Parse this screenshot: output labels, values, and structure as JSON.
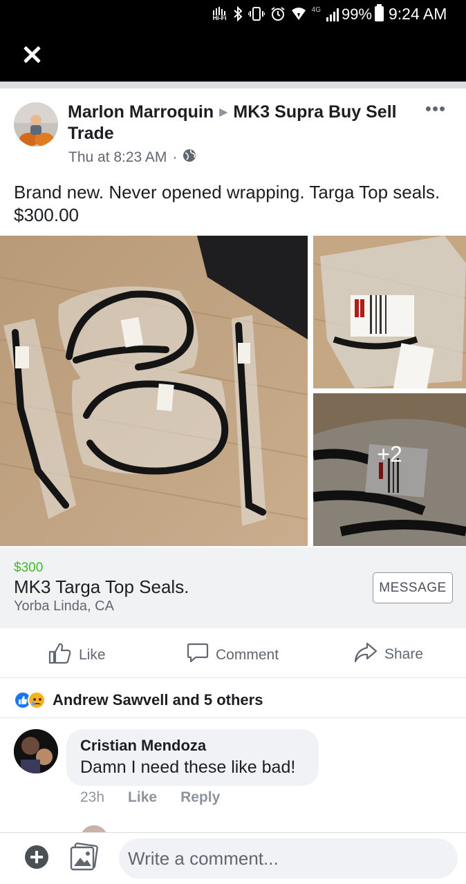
{
  "status_bar": {
    "network_label": "4G",
    "hifi_label": "Hi-Fi",
    "battery": "99%",
    "time": "9:24 AM"
  },
  "post": {
    "author": "Marlon Marroquin",
    "group": "MK3 Supra Buy Sell Trade",
    "timestamp": "Thu at 8:23 AM",
    "dot": "·",
    "body": "Brand new. Never opened wrapping. Targa Top seals. $300.00",
    "more_photos": "+2"
  },
  "listing": {
    "price": "$300",
    "title": "MK3 Targa Top Seals.",
    "location": "Yorba Linda, CA",
    "message_button": "MESSAGE"
  },
  "actions": {
    "like": "Like",
    "comment": "Comment",
    "share": "Share"
  },
  "reactions": {
    "summary": "Andrew Sawvell and 5 others",
    "types": [
      "like",
      "sad"
    ]
  },
  "comment": {
    "author": "Cristian Mendoza",
    "text": "Damn I need these like bad!",
    "age": "23h",
    "like": "Like",
    "reply": "Reply"
  },
  "composer": {
    "placeholder": "Write a comment..."
  },
  "colors": {
    "price_green": "#42b72a",
    "like_blue": "#1877f2",
    "secondary_text": "#606770"
  }
}
